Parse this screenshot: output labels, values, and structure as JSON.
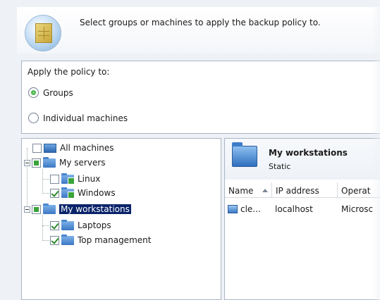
{
  "header": {
    "instruction": "Select groups or machines to apply the backup policy to.",
    "icon": "policy-cube-icon"
  },
  "apply": {
    "label": "Apply the policy to:",
    "options": [
      {
        "label": "Groups",
        "selected": true
      },
      {
        "label": "Individual machines",
        "selected": false
      }
    ]
  },
  "tree": {
    "items": [
      {
        "label": "All machines",
        "checked": false
      },
      {
        "label": "My servers",
        "checked": "partial"
      },
      {
        "label": "Linux",
        "checked": false
      },
      {
        "label": "Windows",
        "checked": true
      },
      {
        "label": "My workstations",
        "checked": "partial",
        "selected": true
      },
      {
        "label": "Laptops",
        "checked": true
      },
      {
        "label": "Top management",
        "checked": true
      }
    ]
  },
  "detail": {
    "title": "My workstations",
    "subtitle": "Static",
    "columns": [
      "Name",
      "IP address",
      "Operat"
    ],
    "rows": [
      {
        "name": "cle...",
        "ip": "localhost",
        "os": "Microsc"
      }
    ]
  },
  "colors": {
    "selection": "#0a246a",
    "panel_border": "#a9b6c5",
    "background": "#eef1f5"
  }
}
